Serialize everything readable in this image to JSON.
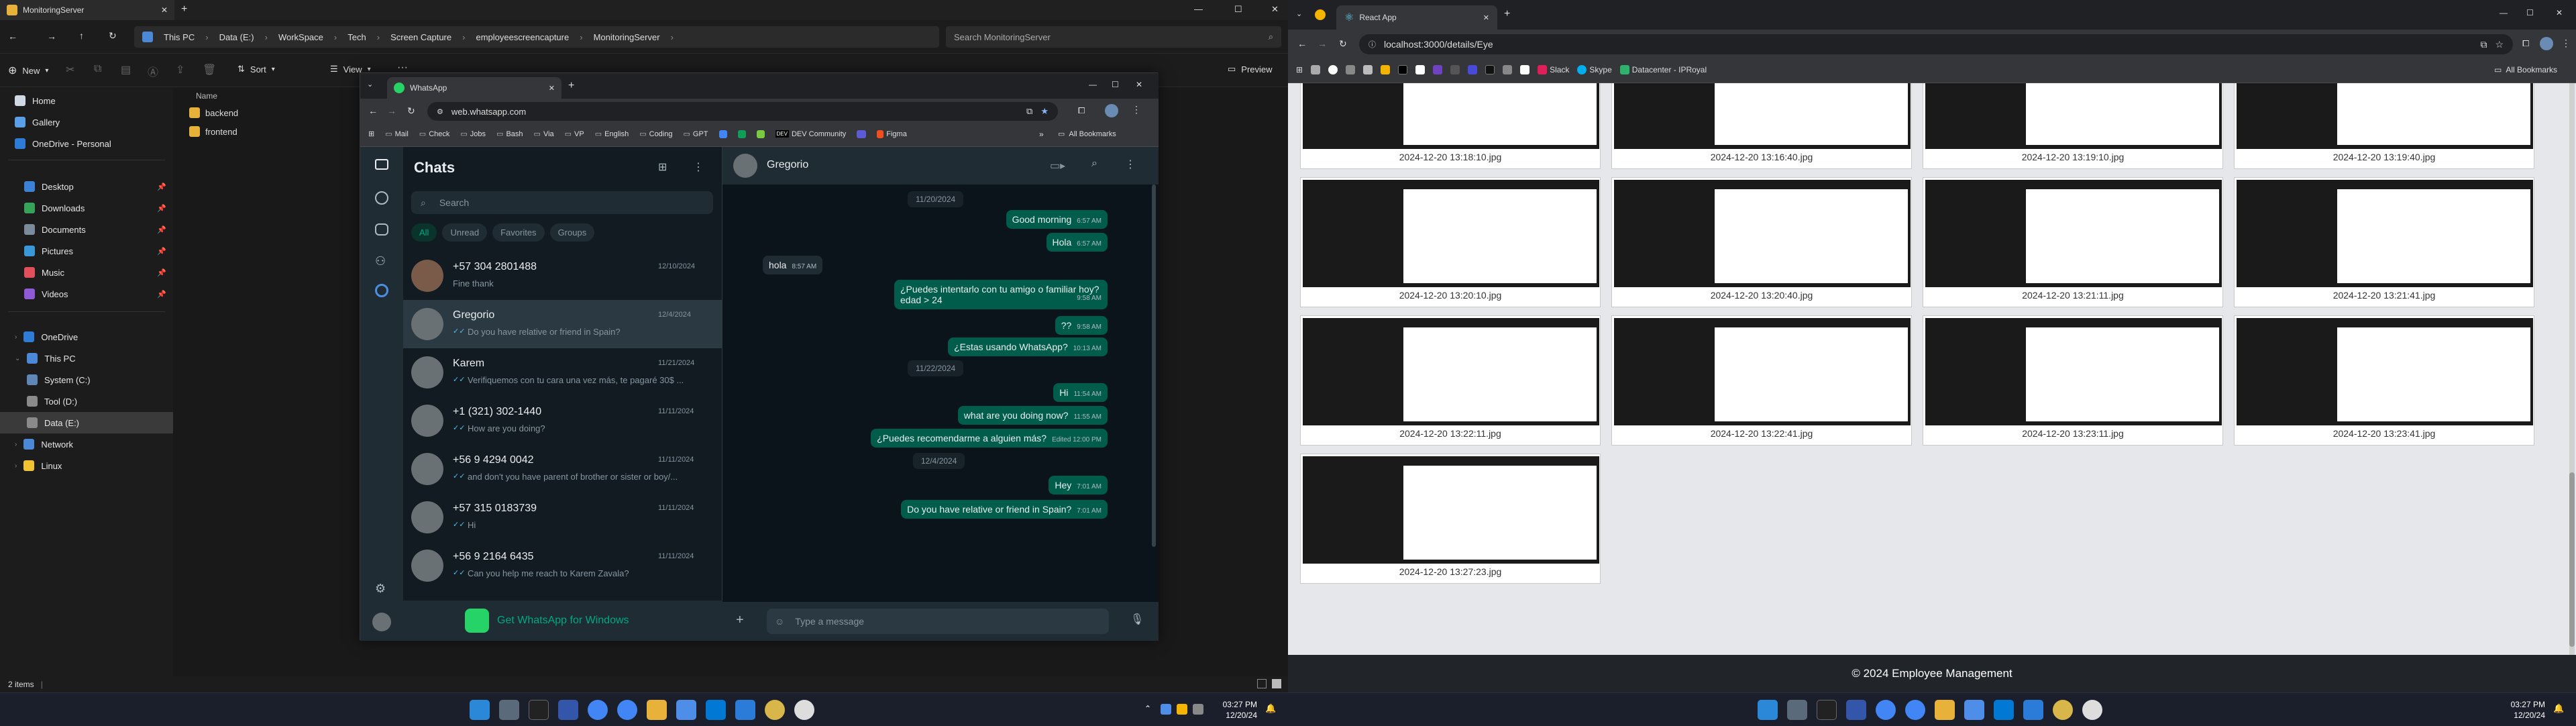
{
  "explorer": {
    "title": "MonitoringServer",
    "breadcrumb": [
      "This PC",
      "Data (E:)",
      "WorkSpace",
      "Tech",
      "Screen Capture",
      "employeescreencapture",
      "MonitoringServer"
    ],
    "search_placeholder": "Search MonitoringServer",
    "new_label": "New",
    "sort_label": "Sort",
    "view_label": "View",
    "preview_label": "Preview",
    "nav": [
      "Home",
      "Gallery",
      "OneDrive - Personal",
      "Desktop",
      "Downloads",
      "Documents",
      "Pictures",
      "Music",
      "Videos",
      "OneDrive",
      "This PC",
      "System (C:)",
      "Tool (D:)",
      "Data (E:)",
      "Network",
      "Linux"
    ],
    "column_name": "Name",
    "files": [
      "backend",
      "frontend"
    ],
    "status": "2 items"
  },
  "whatsapp": {
    "tab_title": "WhatsApp",
    "url": "web.whatsapp.com",
    "bookmarks": [
      "Mail",
      "Check",
      "Jobs",
      "Bash",
      "Via",
      "VP",
      "English",
      "Coding",
      "GPT",
      "DEV Community",
      "Figma"
    ],
    "all_bookmarks": "All Bookmarks",
    "list_title": "Chats",
    "search_placeholder": "Search",
    "filters": [
      "All",
      "Unread",
      "Favorites",
      "Groups"
    ],
    "chats": [
      {
        "name": "+57 304 2801488",
        "time": "12/10/2024",
        "preview": "Fine thank"
      },
      {
        "name": "Gregorio",
        "time": "12/4/2024",
        "preview": "Do you have relative or friend in Spain?"
      },
      {
        "name": "Karem",
        "time": "11/21/2024",
        "preview": "Verifiquemos con tu cara una vez más, te pagaré 30$ ..."
      },
      {
        "name": "+1 (321) 302-1440",
        "time": "11/11/2024",
        "preview": "How are you doing?"
      },
      {
        "name": "+56 9 4294 0042",
        "time": "11/11/2024",
        "preview": "and don't you have parent of brother or sister or boy/..."
      },
      {
        "name": "+57 315 0183739",
        "time": "11/11/2024",
        "preview": "Hi"
      },
      {
        "name": "+56 9 2164 6435",
        "time": "11/11/2024",
        "preview": "Can you help me reach to Karem Zavala?"
      }
    ],
    "get_windows": "Get WhatsApp for Windows",
    "contact": "Gregorio",
    "messages": {
      "d1": "11/20/2024",
      "m1": "Good morning",
      "m1t": "6:57 AM",
      "m2": "Hola",
      "m2t": "6:57 AM",
      "m3": "hola",
      "m3t": "8:57 AM",
      "m4a": "¿Puedes intentarlo con tu amigo o familiar hoy?",
      "m4b": "edad > 24",
      "m4t": "9:58 AM",
      "m5": "??",
      "m5t": "9:58 AM",
      "m6": "¿Estas usando WhatsApp?",
      "m6t": "10:13 AM",
      "d2": "11/22/2024",
      "m7": "Hi",
      "m7t": "11:54 AM",
      "m8": "what are you doing now?",
      "m8t": "11:55 AM",
      "m9": "¿Puedes recomendarme a alguien más?",
      "m9t": "Edited 12:00 PM",
      "d3": "12/4/2024",
      "m10": "Hey",
      "m10t": "7:01 AM",
      "m11": "Do you have relative or friend in Spain?",
      "m11t": "7:01 AM"
    },
    "composer_placeholder": "Type a message"
  },
  "react": {
    "tab_title": "React App",
    "url": "localhost:3000/details/Eye",
    "bookmarks": [
      "Slack",
      "Skype",
      "Datacenter - IPRoyal"
    ],
    "all_bookmarks": "All Bookmarks",
    "captions": [
      "2024-12-20 13:18:10.jpg",
      "2024-12-20 13:16:40.jpg",
      "2024-12-20 13:19:10.jpg",
      "2024-12-20 13:19:40.jpg",
      "2024-12-20 13:20:10.jpg",
      "2024-12-20 13:20:40.jpg",
      "2024-12-20 13:21:11.jpg",
      "2024-12-20 13:21:41.jpg",
      "2024-12-20 13:22:11.jpg",
      "2024-12-20 13:22:41.jpg",
      "2024-12-20 13:23:11.jpg",
      "2024-12-20 13:23:41.jpg",
      "2024-12-20 13:27:23.jpg"
    ],
    "footer": "© 2024 Employee Management"
  },
  "taskbar": {
    "time": "03:27 PM",
    "date": "12/20/24"
  }
}
